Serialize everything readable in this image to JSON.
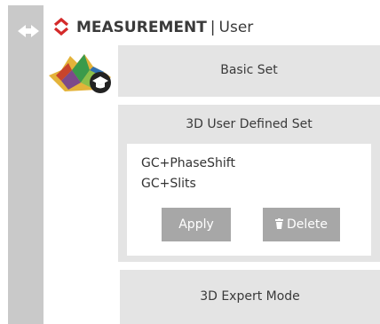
{
  "header": {
    "app_title": "MEASUREMENT",
    "separator": "|",
    "context": "User"
  },
  "sidebar": {
    "collapse_icon": "double-arrow-icon"
  },
  "panels": {
    "basic_set": {
      "label": "Basic Set"
    },
    "user_defined_set": {
      "label": "3D User Defined Set",
      "items": [
        "GC+PhaseShift",
        "GC+Slits"
      ],
      "apply_label": "Apply",
      "delete_label": "Delete",
      "delete_icon": "trash-icon"
    },
    "expert_mode": {
      "label": "3D Expert Mode"
    }
  },
  "colors": {
    "brand_red": "#d42a2a",
    "panel_bg": "#e4e4e4",
    "rail_bg": "#c9c9c9",
    "button_bg": "#a7a7a7"
  }
}
